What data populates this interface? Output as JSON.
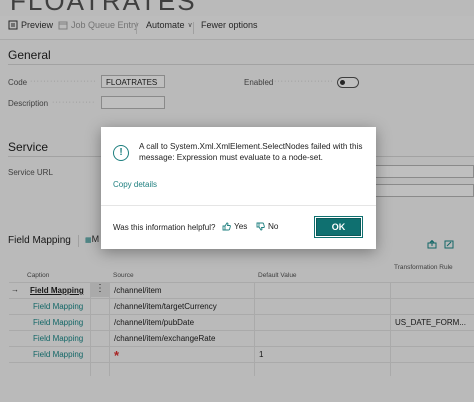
{
  "page": {
    "title_fragment": "FLOATRATES"
  },
  "toolbar": {
    "preview": "Preview",
    "job_queue_entry": "Job Queue Entry",
    "automate": "Automate",
    "fewer_options": "Fewer options"
  },
  "general": {
    "heading": "General",
    "code_label": "Code",
    "code_value": "FLOATRATES",
    "description_label": "Description",
    "description_value": "",
    "enabled_label": "Enabled",
    "enabled": false
  },
  "service": {
    "heading": "Service",
    "service_url_label": "Service URL",
    "service_url_value": ""
  },
  "field_mapping": {
    "heading": "Field Mapping",
    "toolbar_fragment": "M",
    "columns": [
      "Caption",
      "Source",
      "Default Value",
      "Transformation Rule"
    ],
    "rows": [
      {
        "caption": "Field Mapping",
        "source": "/channel/item",
        "default": "",
        "rule": "",
        "selected": true
      },
      {
        "caption": "Field Mapping",
        "source": "/channel/item/targetCurrency",
        "default": "",
        "rule": ""
      },
      {
        "caption": "Field Mapping",
        "source": "/channel/item/pubDate",
        "default": "",
        "rule": "US_DATE_FORM..."
      },
      {
        "caption": "Field Mapping",
        "source": "/channel/item/exchangeRate",
        "default": "",
        "rule": ""
      },
      {
        "caption": "Field Mapping",
        "source": "*",
        "default": "1",
        "rule": ""
      }
    ]
  },
  "dialog": {
    "message": "A call to System.Xml.XmlElement.SelectNodes failed with this message: Expression must evaluate to a node-set.",
    "copy_details": "Copy details",
    "helpful_question": "Was this information helpful?",
    "yes": "Yes",
    "no": "No",
    "ok": "OK"
  },
  "colors": {
    "accent": "#0f7070",
    "link": "#1a8a8a",
    "required": "#e03030"
  }
}
